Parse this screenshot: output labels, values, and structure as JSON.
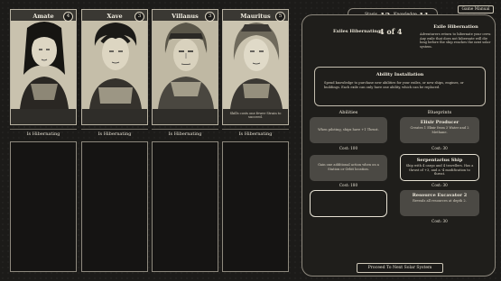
{
  "crew": [
    {
      "name": "Amate",
      "level": "4",
      "status": "Is Hibernating",
      "desc": ""
    },
    {
      "name": "Xave",
      "level": "3",
      "status": "Is Hibernating",
      "desc": ""
    },
    {
      "name": "Villanus",
      "level": "3",
      "status": "Is Hibernating",
      "desc": ""
    },
    {
      "name": "Mauritus",
      "level": "5",
      "status": "Is Hibernating",
      "desc": "Skills costs one fewer Strain to succeed."
    }
  ],
  "header": {
    "stasis_label": "Stasis",
    "stasis_value": "12",
    "knowledge_label": "Knowledge",
    "knowledge_value": "11",
    "game_manual": "Game Manual"
  },
  "exiles": {
    "label": "Exiles Hibernating:",
    "value": "4 of 4",
    "info_title": "Exile Hibernation",
    "info_text": "Adventurers return to hibernate your crew. Any exile that does not hibernate will die long before the ship reaches the next solar system."
  },
  "ability": {
    "title": "Ability Installation",
    "text": "Spend knowledge to purchase new abilities for your exiles, or new ships, engines, or buildings. Each exile can only have one ability, which can be replaced."
  },
  "abilities": {
    "heading": "Abilities",
    "items": [
      {
        "text": "When piloting, ships have +1 Thrust.",
        "cost": "Cost: 100"
      },
      {
        "text": "Gain one additional action when on a Station or Orbit location.",
        "cost": "Cost: 180"
      }
    ]
  },
  "blueprints": {
    "heading": "Blueprints",
    "items": [
      {
        "title": "Elixir Producer",
        "text": "Creates 1 Elixir from 3 Water and 2 Methane.",
        "cost": "Cost: 30"
      },
      {
        "title": "Serpentarius Ship",
        "text": "Ship with 4 cargo and 4 travellers. Has a thrust of +3, and a -4 modification to threat.",
        "cost": "Cost: 30"
      },
      {
        "title": "Resource Excavator 2",
        "text": "Reveals all resources at depth 2.",
        "cost": "Cost: 30"
      }
    ]
  },
  "proceed": "Proceed To Next Solar System"
}
